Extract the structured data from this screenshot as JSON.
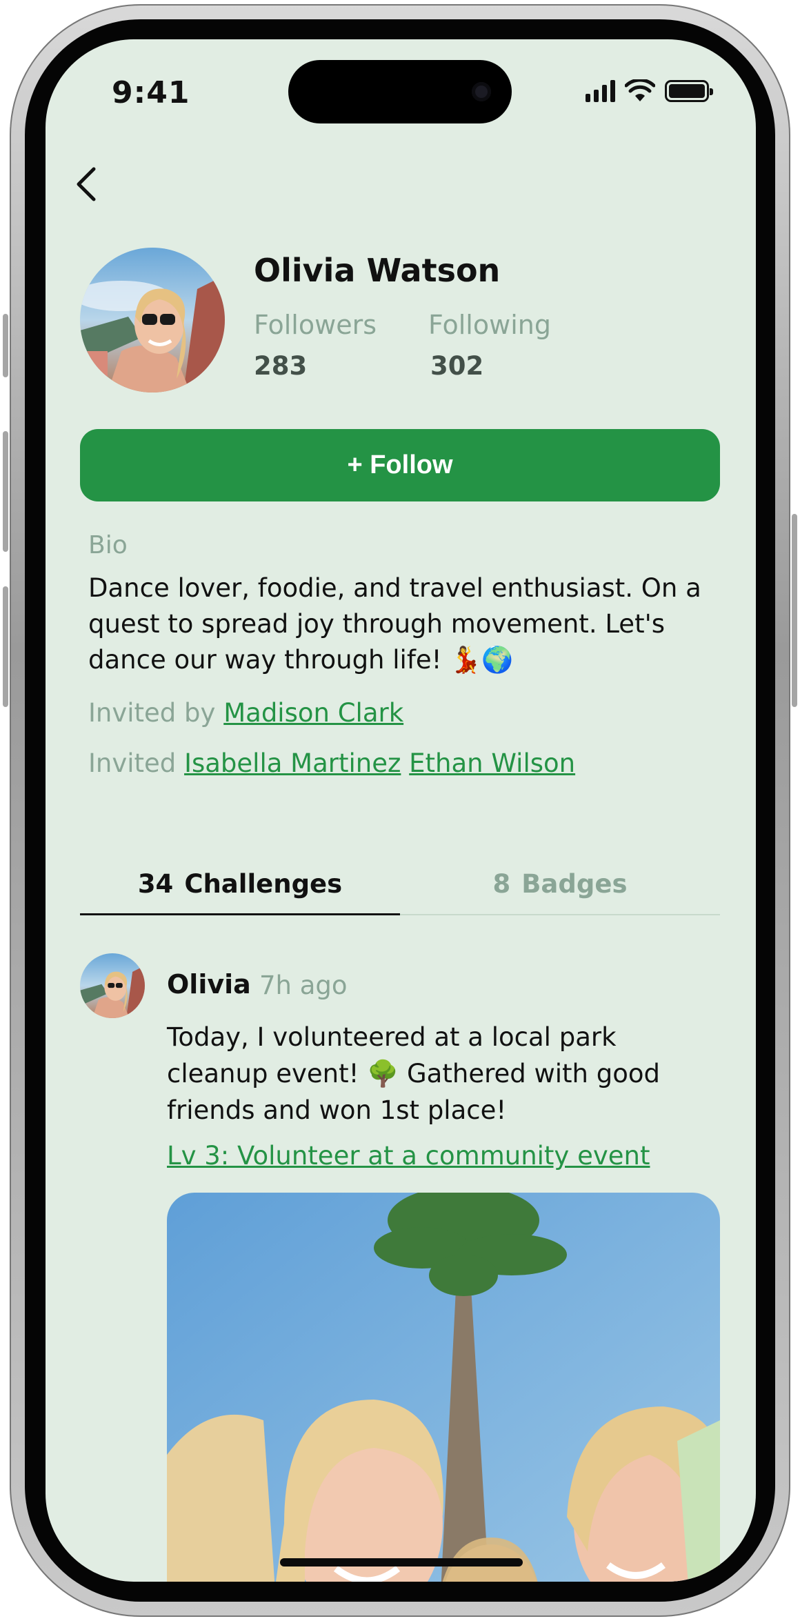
{
  "status_bar": {
    "time": "9:41"
  },
  "profile": {
    "name": "Olivia Watson",
    "followers_label": "Followers",
    "followers_count": "283",
    "following_label": "Following",
    "following_count": "302",
    "follow_button": "+ Follow"
  },
  "bio": {
    "label": "Bio",
    "text": "Dance lover, foodie, and travel enthusiast. On a quest to spread joy through movement. Let's dance our way through life! 💃🌍",
    "invited_by_label": "Invited by",
    "invited_by_name": "Madison Clark",
    "invited_label": "Invited",
    "invited_names": [
      "Isabella Martinez",
      "Ethan Wilson"
    ]
  },
  "tabs": [
    {
      "count": "34",
      "label": "Challenges",
      "active": true
    },
    {
      "count": "8",
      "label": "Badges",
      "active": false
    }
  ],
  "post": {
    "author": "Olivia",
    "time": "7h ago",
    "text": "Today, I volunteered at a local park cleanup event! 🌳 Gathered with good friends and won 1st place!",
    "challenge_link": "Lv 3: Volunteer at a community event"
  },
  "colors": {
    "background": "#e1ede3",
    "accent": "#249345",
    "muted": "#8aa596"
  },
  "icons": [
    "back-chevron-icon",
    "signal-icon",
    "wifi-icon",
    "battery-icon"
  ]
}
